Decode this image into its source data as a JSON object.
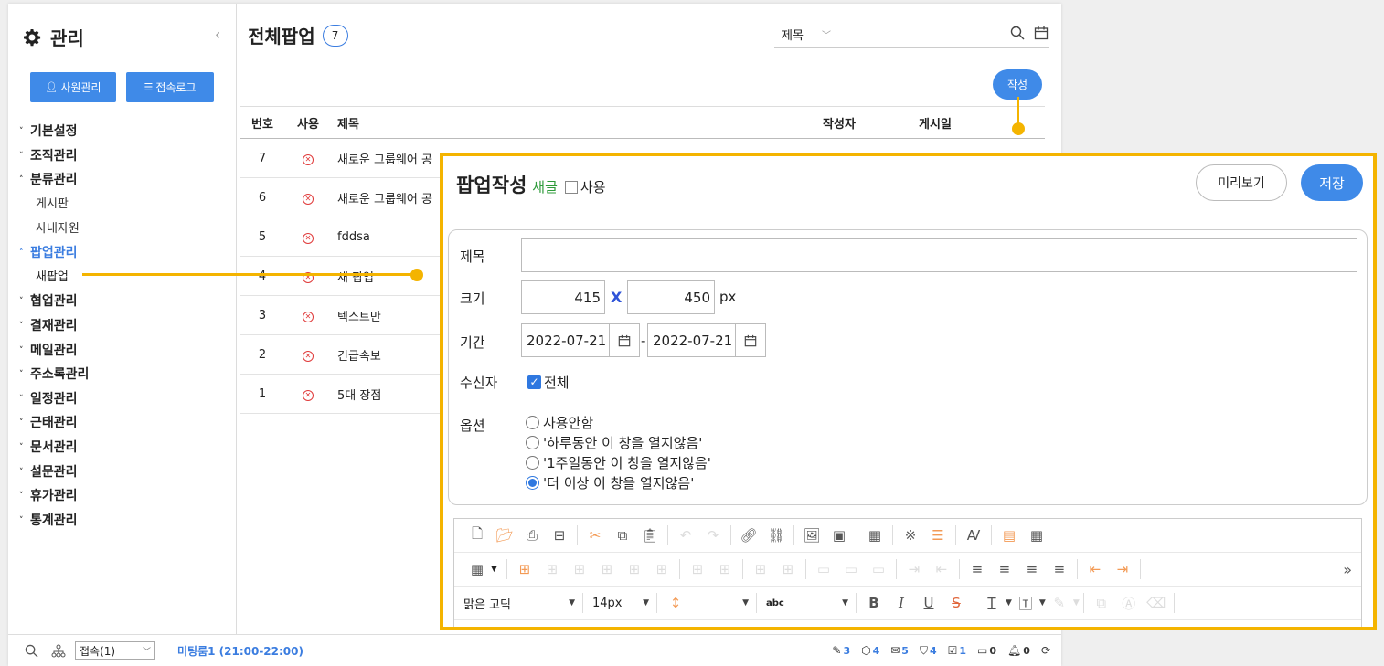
{
  "sidebar": {
    "title": "관리",
    "buttons": {
      "employee": "사원관리",
      "access_log": "접속로그"
    },
    "menu": [
      {
        "label": "기본설정",
        "arrow": "˅"
      },
      {
        "label": "조직관리",
        "arrow": "˅"
      },
      {
        "label": "분류관리",
        "arrow": "˄"
      },
      {
        "label": "게시판",
        "sub": true
      },
      {
        "label": "사내자원",
        "sub": true
      },
      {
        "label": "팝업관리",
        "arrow": "˄"
      },
      {
        "label": "새팝업",
        "sub": true
      },
      {
        "label": "협업관리",
        "arrow": "˅"
      },
      {
        "label": "결재관리",
        "arrow": "˅"
      },
      {
        "label": "메일관리",
        "arrow": "˅"
      },
      {
        "label": "주소록관리",
        "arrow": "˅"
      },
      {
        "label": "일정관리",
        "arrow": "˅"
      },
      {
        "label": "근태관리",
        "arrow": "˅"
      },
      {
        "label": "문서관리",
        "arrow": "˅"
      },
      {
        "label": "설문관리",
        "arrow": "˅"
      },
      {
        "label": "휴가관리",
        "arrow": "˅"
      },
      {
        "label": "통계관리",
        "arrow": "˅"
      }
    ]
  },
  "main": {
    "title": "전체팝업",
    "count": "7",
    "search_field": "제목",
    "write_label": "작성",
    "columns": {
      "no": "번호",
      "use": "사용",
      "title": "제목",
      "author": "작성자",
      "date": "게시일"
    },
    "rows": [
      {
        "no": "7",
        "title": "새로운 그룹웨어 공"
      },
      {
        "no": "6",
        "title": "새로운 그룹웨어 공"
      },
      {
        "no": "5",
        "title": "fddsa"
      },
      {
        "no": "4",
        "title": "새 팝업"
      },
      {
        "no": "3",
        "title": "텍스트만"
      },
      {
        "no": "2",
        "title": "긴급속보"
      },
      {
        "no": "1",
        "title": "5대 장점"
      }
    ]
  },
  "bottom": {
    "status": "접속(1)",
    "meeting": "미팅룸1 (21:00-22:00)",
    "counts": {
      "pen": "3",
      "box": "4",
      "mail": "5",
      "shield": "4",
      "calendar": "1",
      "chat": "0",
      "bell": "0"
    }
  },
  "popup": {
    "title": "팝업작성",
    "new_label": "새글",
    "use_label": "사용",
    "preview_label": "미리보기",
    "save_label": "저장",
    "labels": {
      "title": "제목",
      "size": "크기",
      "period": "기간",
      "recipient": "수신자",
      "option": "옵션"
    },
    "width": "415",
    "x_label": "X",
    "height": "450",
    "unit": "px",
    "date_start": "2022-07-21",
    "date_sep": "-",
    "date_end": "2022-07-21",
    "recipient_all": "전체",
    "options": [
      {
        "label": "사용안함",
        "selected": false
      },
      {
        "label": "'하루동안 이 창을 열지않음'",
        "selected": false
      },
      {
        "label": "'1주일동안 이 창을 열지않음'",
        "selected": false
      },
      {
        "label": "'더 이상 이 창을 열지않음'",
        "selected": true
      }
    ],
    "editor": {
      "font": "맑은 고딕",
      "size": "14px"
    }
  },
  "accent_color": "#3f8ae8",
  "highlight_color": "#f4b400"
}
